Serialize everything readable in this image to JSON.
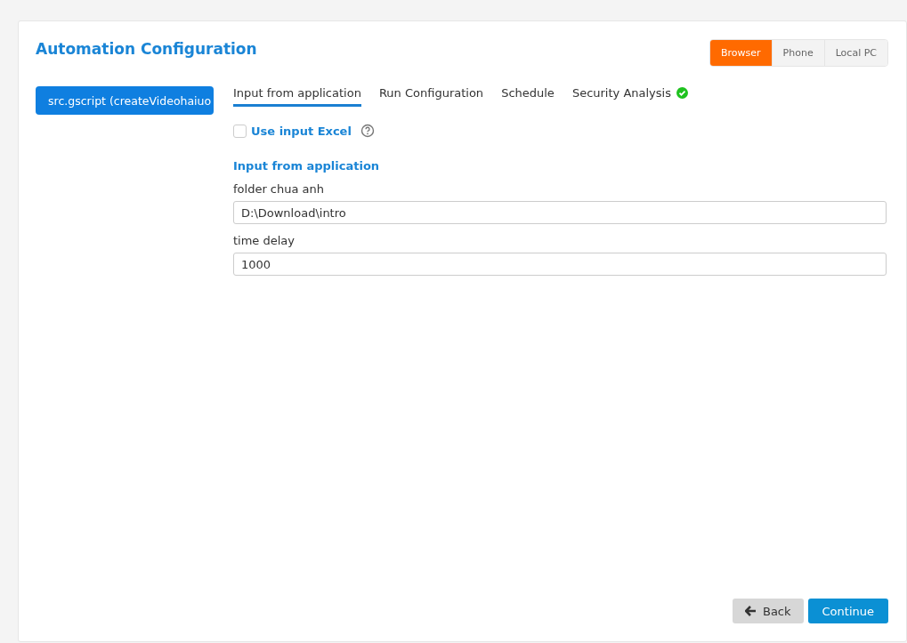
{
  "title": "Automation Configuration",
  "platforms": [
    {
      "label": "Browser",
      "selected": true
    },
    {
      "label": "Phone",
      "selected": false
    },
    {
      "label": "Local PC",
      "selected": false
    }
  ],
  "scripts": [
    {
      "label": "src.gscript  (createVideohaiuo",
      "selected": true
    }
  ],
  "tabs": [
    {
      "label": "Input from application",
      "selected": true,
      "verified": false
    },
    {
      "label": "Run Configuration",
      "selected": false,
      "verified": false
    },
    {
      "label": "Schedule",
      "selected": false,
      "verified": false
    },
    {
      "label": "Security Analysis",
      "selected": false,
      "verified": true
    }
  ],
  "use_excel": {
    "label": "Use input Excel",
    "checked": false
  },
  "section_title": "Input from application",
  "fields": [
    {
      "label": "folder chua anh",
      "value": "D:\\Download\\intro"
    },
    {
      "label": "time delay",
      "value": "1000"
    }
  ],
  "back_button": "Back",
  "continue_button": "Continue"
}
